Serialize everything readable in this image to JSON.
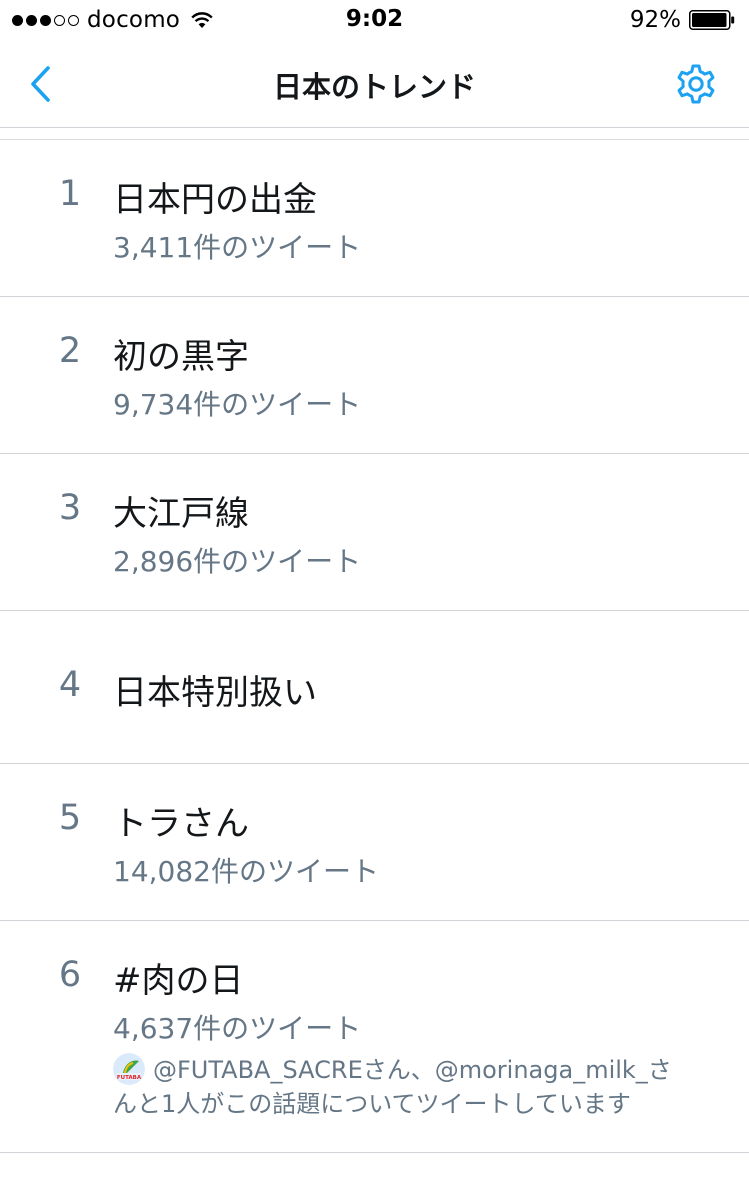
{
  "status_bar": {
    "carrier": "docomo",
    "time": "9:02",
    "battery_percent": "92%",
    "signal_strength": 3,
    "signal_max": 5
  },
  "nav": {
    "title": "日本のトレンド",
    "back_icon": "chevron-left-icon",
    "settings_icon": "gear-icon",
    "accent_color": "#1da1f2"
  },
  "trends": [
    {
      "rank": "1",
      "name": "日本円の出金",
      "count": "3,411件のツイート"
    },
    {
      "rank": "2",
      "name": "初の黒字",
      "count": "9,734件のツイート"
    },
    {
      "rank": "3",
      "name": "大江戸線",
      "count": "2,896件のツイート"
    },
    {
      "rank": "4",
      "name": "日本特別扱い"
    },
    {
      "rank": "5",
      "name": "トラさん",
      "count": "14,082件のツイート"
    },
    {
      "rank": "6",
      "name": "#肉の日",
      "count": "4,637件のツイート",
      "context_line1": "@FUTABA_SACREさん、@morinaga_milk_さ",
      "context_line2": "んと1人がこの話題についてツイートしています",
      "avatar_text": "FUTABA"
    }
  ]
}
